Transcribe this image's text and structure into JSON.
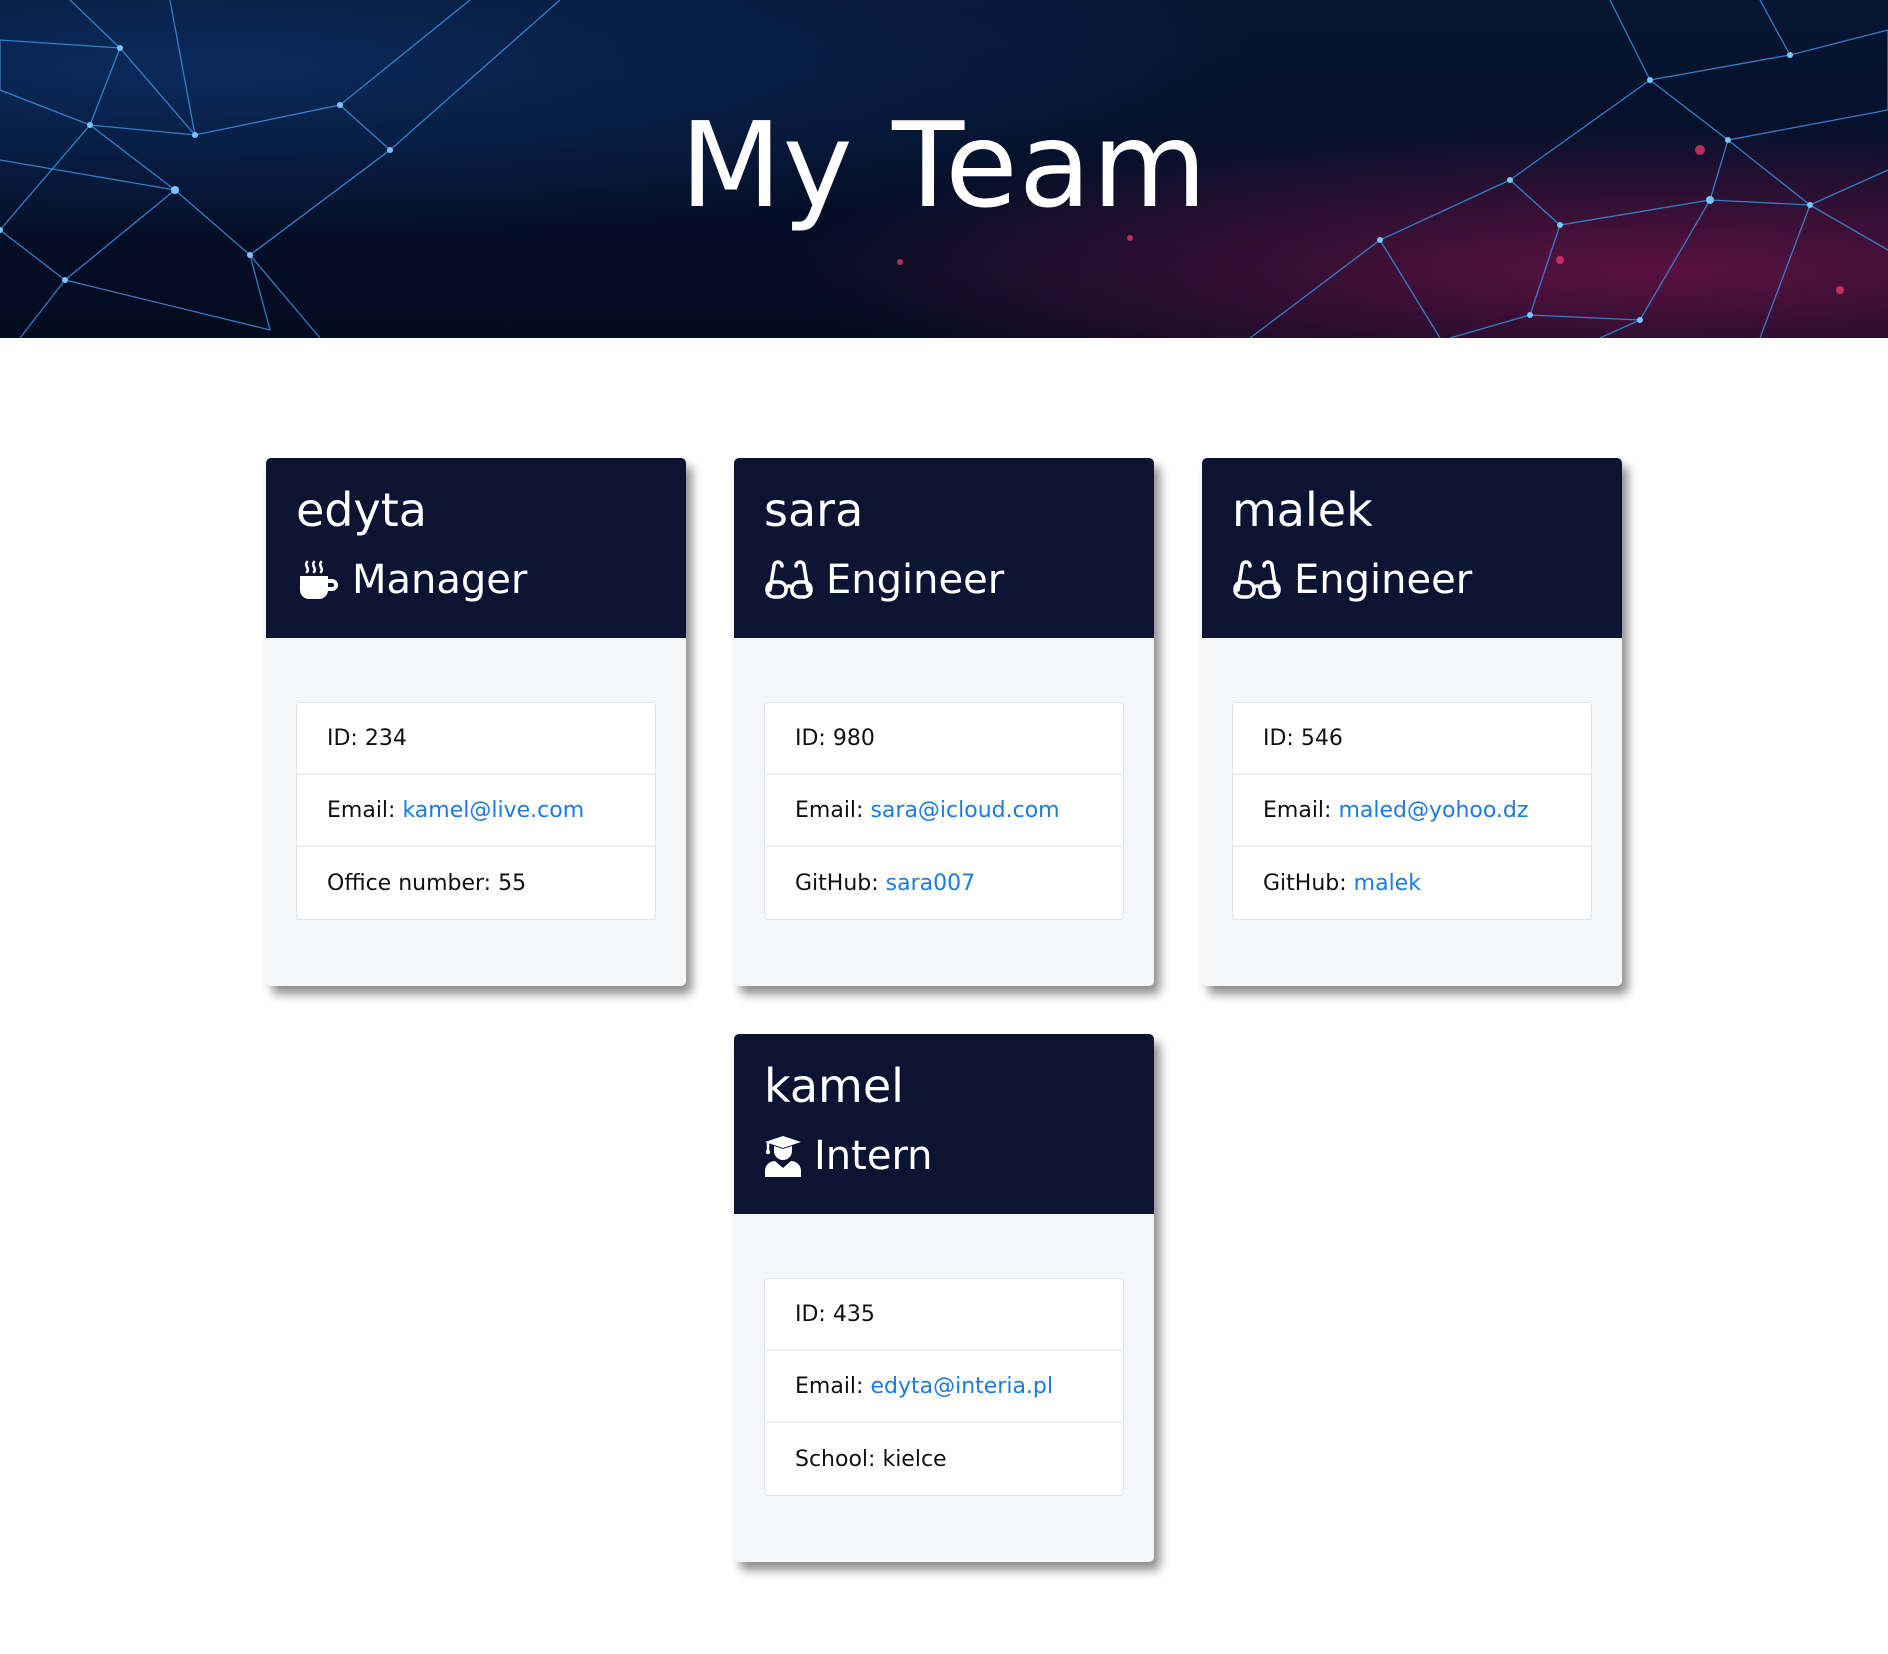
{
  "header": {
    "title": "My Team"
  },
  "team": [
    {
      "name": "edyta",
      "role": "Manager",
      "role_icon": "mug-hot-icon",
      "id_label": "ID:",
      "id": "234",
      "email_label": "Email:",
      "email": "kamel@live.com",
      "extra_label": "Office number:",
      "extra_value": "55"
    },
    {
      "name": "sara",
      "role": "Engineer",
      "role_icon": "glasses-icon",
      "id_label": "ID:",
      "id": "980",
      "email_label": "Email:",
      "email": "sara@icloud.com",
      "extra_label": "GitHub:",
      "extra_value": "sara007"
    },
    {
      "name": "malek",
      "role": "Engineer",
      "role_icon": "glasses-icon",
      "id_label": "ID:",
      "id": "546",
      "email_label": "Email:",
      "email": "maled@yohoo.dz",
      "extra_label": "GitHub:",
      "extra_value": "malek"
    },
    {
      "name": "kamel",
      "role": "Intern",
      "role_icon": "user-graduate-icon",
      "id_label": "ID:",
      "id": "435",
      "email_label": "Email:",
      "email": "edyta@interia.pl",
      "extra_label": "School:",
      "extra_value": "kielce"
    }
  ],
  "colors": {
    "card_header": "#0c1433",
    "link": "#1a7be3",
    "card_body": "#f5f6f8"
  }
}
